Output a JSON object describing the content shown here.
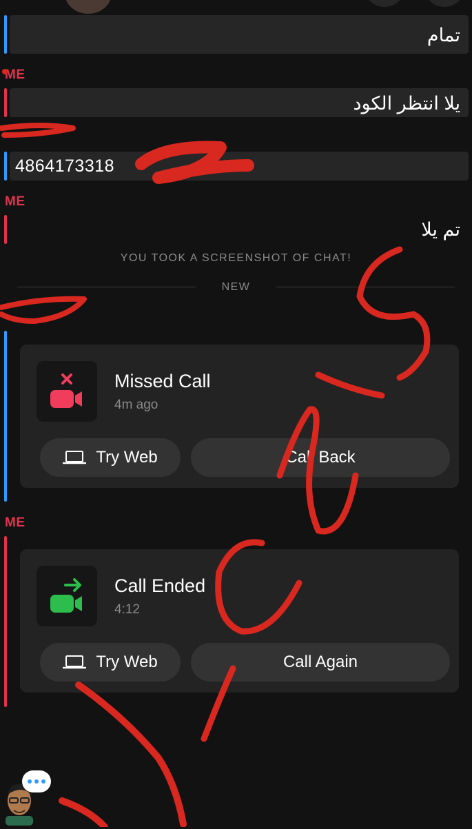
{
  "colors": {
    "background": "#121212",
    "bubble": "#262626",
    "card": "#232323",
    "me_accent": "#e0344e",
    "friend_accent": "#2f9bff",
    "missed_icon": "#f23c5c",
    "ended_icon": "#2dbd4c",
    "scribble": "#d8281f"
  },
  "chat": {
    "message_1": "تمام",
    "sender_me_1": "ME",
    "message_2": "يلا انتظر الكود",
    "message_3": "4864173318",
    "sender_me_2": "ME",
    "message_4": "تم يلا",
    "system_notice": "YOU TOOK A SCREENSHOT OF CHAT!",
    "divider_label": "NEW",
    "sender_me_3": "ME"
  },
  "missed_call": {
    "title": "Missed Call",
    "time": "4m ago",
    "try_web_label": "Try Web",
    "action_label": "Call Back",
    "icon": "video-missed-icon"
  },
  "call_ended": {
    "title": "Call Ended",
    "duration": "4:12",
    "try_web_label": "Try Web",
    "action_label": "Call Again",
    "icon": "video-outgoing-icon"
  },
  "typing_indicator": {
    "icon": "typing-bubble-icon"
  }
}
